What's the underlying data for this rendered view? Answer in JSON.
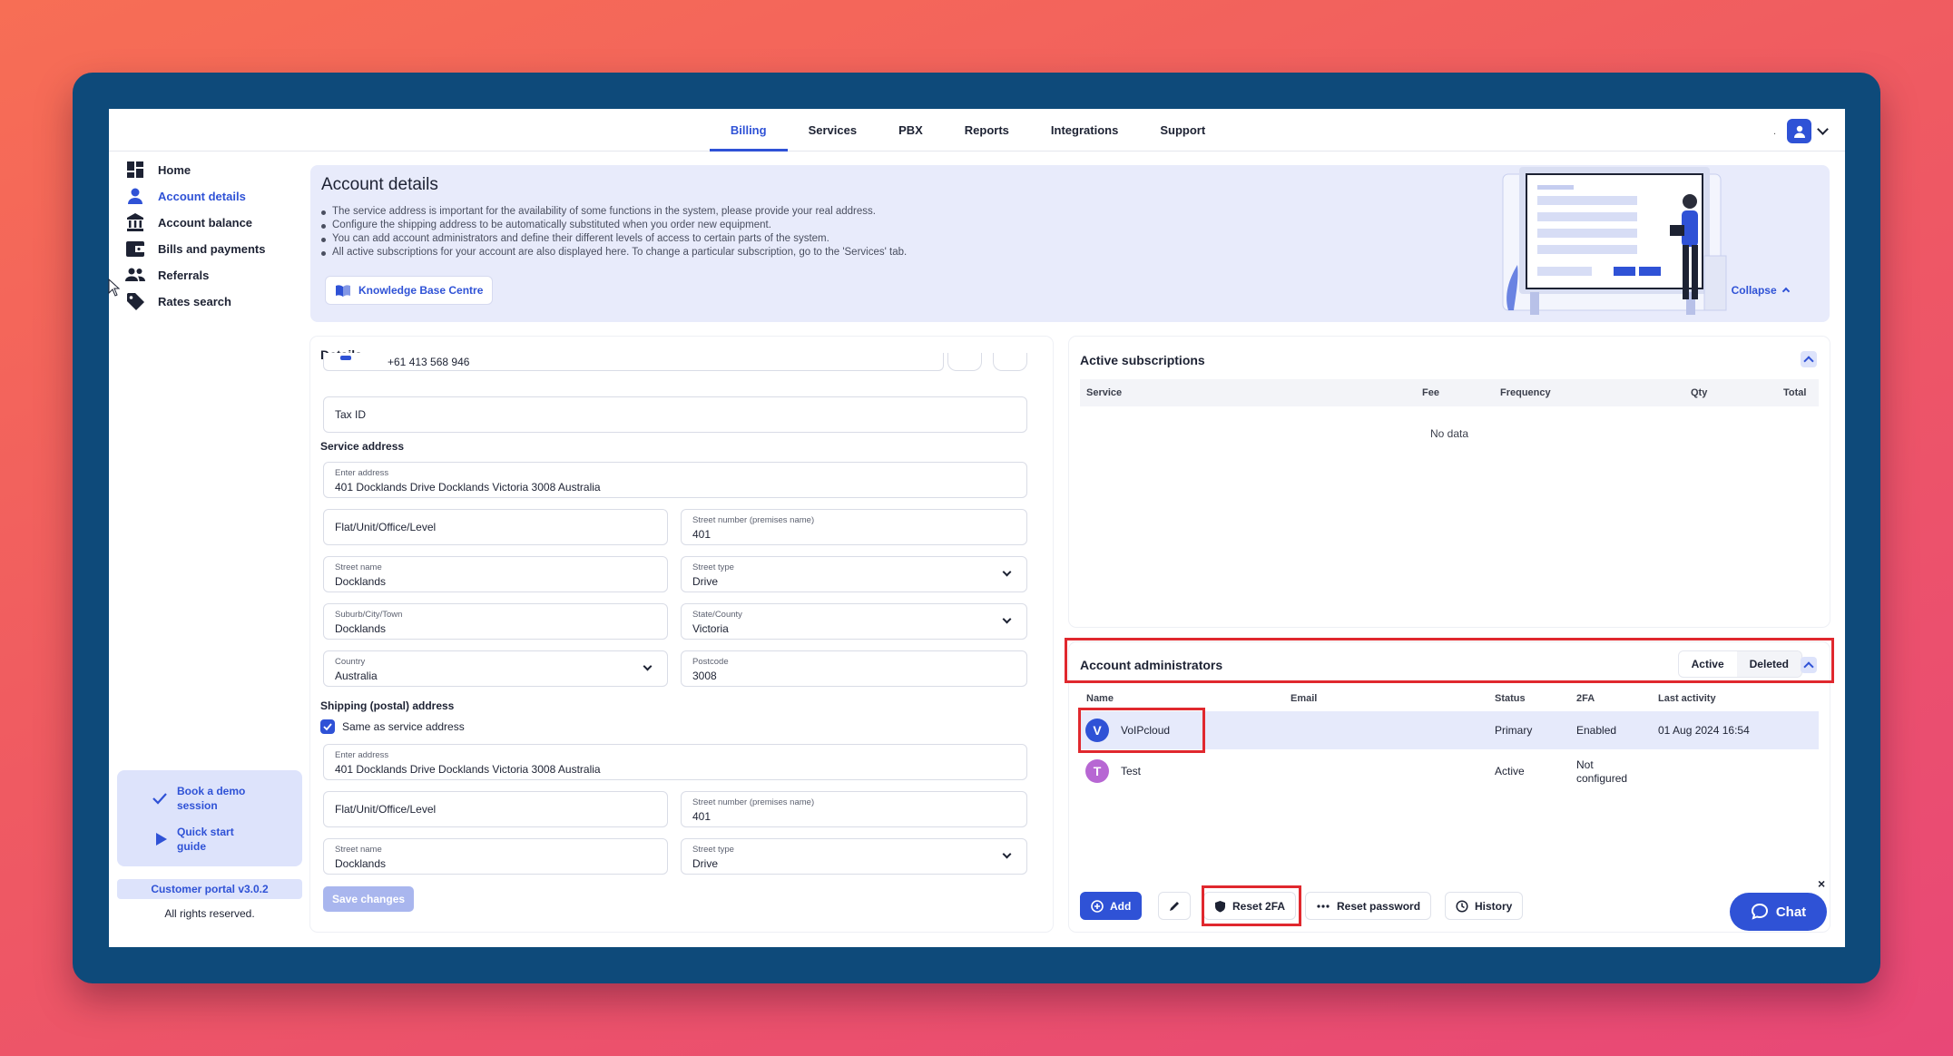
{
  "nav": {
    "tabs": [
      "Billing",
      "Services",
      "PBX",
      "Reports",
      "Integrations",
      "Support"
    ],
    "active_tab": "Billing",
    "dot": "."
  },
  "sidebar": {
    "items": [
      {
        "label": "Home",
        "icon": "dashboard-icon"
      },
      {
        "label": "Account details",
        "icon": "user-icon"
      },
      {
        "label": "Account balance",
        "icon": "bank-icon"
      },
      {
        "label": "Bills and payments",
        "icon": "wallet-icon"
      },
      {
        "label": "Referrals",
        "icon": "people-icon"
      },
      {
        "label": "Rates search",
        "icon": "tag-icon"
      }
    ],
    "demo": "Book a demo session",
    "demo_lines": [
      "Book a demo",
      "session"
    ],
    "guide_lines": [
      "Quick start",
      "guide"
    ],
    "version": "Customer portal v3.0.2",
    "rights": "All rights reserved."
  },
  "banner": {
    "title": "Account details",
    "bullets": [
      "The service address is important for the availability of some functions in the system, please provide your real address.",
      "Configure the shipping address to be automatically substituted when you order new equipment.",
      "You can add account administrators and define their different levels of access to certain parts of the system.",
      "All active subscriptions for your account are also displayed here. To change a particular subscription, go to the 'Services' tab."
    ],
    "kb_button": "Knowledge Base Centre",
    "collapse": "Collapse"
  },
  "details": {
    "title": "Details",
    "phone": "+61 413 568 946",
    "tax_id_placeholder": "Tax ID",
    "service_address_label": "Service address",
    "shipping_label": "Shipping (postal) address",
    "same_as_service": "Same as service address",
    "save": "Save changes",
    "service": {
      "enter_address_label": "Enter address",
      "enter_address": "401 Docklands Drive Docklands Victoria 3008 Australia",
      "flat_placeholder": "Flat/Unit/Office/Level",
      "street_number_label": "Street number (premises name)",
      "street_number": "401",
      "street_name_label": "Street name",
      "street_name": "Docklands",
      "street_type_label": "Street type",
      "street_type": "Drive",
      "suburb_label": "Suburb/City/Town",
      "suburb": "Docklands",
      "state_label": "State/County",
      "state": "Victoria",
      "country_label": "Country",
      "country": "Australia",
      "postcode_label": "Postcode",
      "postcode": "3008"
    },
    "shipping": {
      "enter_address_label": "Enter address",
      "enter_address": "401 Docklands Drive Docklands Victoria 3008 Australia",
      "flat_placeholder": "Flat/Unit/Office/Level",
      "street_number_label": "Street number (premises name)",
      "street_number": "401",
      "street_name_label": "Street name",
      "street_name": "Docklands",
      "street_type_label": "Street type",
      "street_type": "Drive"
    }
  },
  "subscriptions": {
    "title": "Active subscriptions",
    "columns": [
      "Service",
      "Fee",
      "Frequency",
      "Qty",
      "Total"
    ],
    "empty": "No data"
  },
  "admins": {
    "title": "Account administrators",
    "filter_active": "Active",
    "filter_deleted": "Deleted",
    "columns": [
      "Name",
      "Email",
      "Status",
      "2FA",
      "Last activity"
    ],
    "rows": [
      {
        "initial": "V",
        "name": "VoIPcloud",
        "email": "",
        "status": "Primary",
        "twofa": "Enabled",
        "last": "01 Aug 2024 16:54",
        "color": "#2f52d6"
      },
      {
        "initial": "T",
        "name": "Test",
        "email": "",
        "status": "Active",
        "twofa": "Not configured",
        "twofa_lines": [
          "Not",
          "configured"
        ],
        "last": "",
        "color": "#b767d3"
      }
    ],
    "buttons": {
      "add": "Add",
      "reset2fa": "Reset 2FA",
      "reset_password": "Reset password",
      "history": "History"
    }
  },
  "chat": {
    "label": "Chat",
    "close": "×"
  },
  "colors": {
    "accent": "#2f52d6",
    "highlight": "#e0282e",
    "frame": "#0e4a7a"
  }
}
